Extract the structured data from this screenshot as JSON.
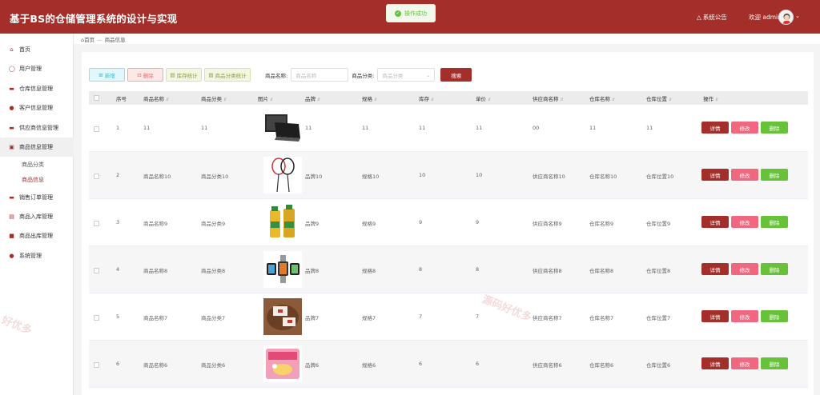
{
  "header": {
    "title": "基于BS的仓储管理系统的设计与实现",
    "notice_label": "系统公告",
    "welcome": "欢迎 admin"
  },
  "toast": {
    "text": "操作成功"
  },
  "sidebar": {
    "items": [
      {
        "label": "首页",
        "icon": "home-icon"
      },
      {
        "label": "用户管理",
        "icon": "user-icon"
      },
      {
        "label": "仓库信息管理",
        "icon": "warehouse-icon"
      },
      {
        "label": "客户信息管理",
        "icon": "customer-icon"
      },
      {
        "label": "供应商信息管理",
        "icon": "supplier-icon"
      },
      {
        "label": "商品信息管理",
        "icon": "goods-icon"
      },
      {
        "label": "销售订单管理",
        "icon": "sales-icon"
      },
      {
        "label": "商品入库管理",
        "icon": "inbound-icon"
      },
      {
        "label": "商品出库管理",
        "icon": "outbound-icon"
      },
      {
        "label": "系统管理",
        "icon": "system-icon"
      }
    ],
    "submenu": [
      "商品分类",
      "商品信息"
    ]
  },
  "breadcrumb": {
    "home": "首页",
    "current": "商品信息"
  },
  "toolbar": {
    "add": "新增",
    "delete": "删除",
    "stock_stats": "库存统计",
    "category_stats": "商品分类统计",
    "name_label": "商品名称:",
    "name_placeholder": "商品名称",
    "category_label": "商品分类:",
    "category_placeholder": "商品分类",
    "search": "搜索"
  },
  "table": {
    "columns": [
      "序号",
      "商品名称",
      "商品分类",
      "图片",
      "品牌",
      "规格",
      "库存",
      "单价",
      "供应商名称",
      "仓库名称",
      "仓库位置",
      "操作"
    ],
    "rows": [
      {
        "no": "1",
        "name": "11",
        "category": "11",
        "image": "laptop",
        "brand": "11",
        "spec": "11",
        "stock": "11",
        "price": "11",
        "supplier": "00",
        "warehouse": "11",
        "location": "11"
      },
      {
        "no": "2",
        "name": "商品名称10",
        "category": "商品分类10",
        "image": "badminton-rackets",
        "brand": "品牌10",
        "spec": "规格10",
        "stock": "10",
        "price": "10",
        "supplier": "供应商名称10",
        "warehouse": "仓库名称10",
        "location": "仓库位置10"
      },
      {
        "no": "3",
        "name": "商品名称9",
        "category": "商品分类9",
        "image": "juice-bottles",
        "brand": "品牌9",
        "spec": "规格9",
        "stock": "9",
        "price": "9",
        "supplier": "供应商名称9",
        "warehouse": "仓库名称9",
        "location": "仓库位置9"
      },
      {
        "no": "4",
        "name": "商品名称8",
        "category": "商品分类8",
        "image": "smartwatches",
        "brand": "品牌8",
        "spec": "规格8",
        "stock": "8",
        "price": "8",
        "supplier": "供应商名称8",
        "warehouse": "仓库名称8",
        "location": "仓库位置8"
      },
      {
        "no": "5",
        "name": "商品名称7",
        "category": "商品分类7",
        "image": "gift-box",
        "brand": "品牌7",
        "spec": "规格7",
        "stock": "7",
        "price": "7",
        "supplier": "供应商名称7",
        "warehouse": "仓库名称7",
        "location": "仓库位置7"
      },
      {
        "no": "6",
        "name": "商品名称6",
        "category": "商品分类6",
        "image": "noodle-pack",
        "brand": "品牌6",
        "spec": "规格6",
        "stock": "6",
        "price": "6",
        "supplier": "供应商名称6",
        "warehouse": "仓库名称6",
        "location": "仓库位置6"
      }
    ],
    "actions": {
      "detail": "详情",
      "edit": "修改",
      "delete": "删除"
    }
  },
  "watermark": "源码好优多",
  "colors": {
    "primary": "#a42f2a",
    "edit": "#f0677f",
    "delete": "#67c23a"
  }
}
